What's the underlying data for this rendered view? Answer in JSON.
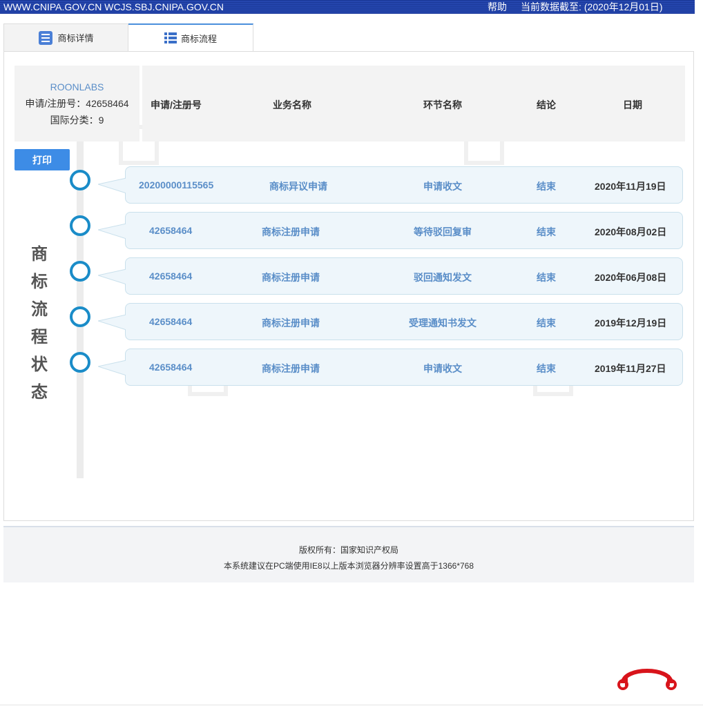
{
  "topbar": {
    "domains": "WWW.CNIPA.GOV.CN WCJS.SBJ.CNIPA.GOV.CN",
    "help": "帮助",
    "data_date_label": "当前数据截至:",
    "data_date_value": "(2020年12月01日)"
  },
  "tabs": [
    {
      "label": "商标详情",
      "icon": "list-icon"
    },
    {
      "label": "商标流程",
      "icon": "grid-list-icon"
    }
  ],
  "info": {
    "brand": "ROONLABS",
    "reg_no_line": "申请/注册号：42658464",
    "class_line": "国际分类：9"
  },
  "table": {
    "headers": [
      "申请/注册号",
      "业务名称",
      "环节名称",
      "结论",
      "日期"
    ]
  },
  "print_label": "打印",
  "vertical_title": [
    "商",
    "标",
    "流",
    "程",
    "状",
    "态"
  ],
  "rows": [
    {
      "reg_no": "20200000115565",
      "business": "商标异议申请",
      "step": "申请收文",
      "result": "结束",
      "date": "2020年11月19日"
    },
    {
      "reg_no": "42658464",
      "business": "商标注册申请",
      "step": "等待驳回复审",
      "result": "结束",
      "date": "2020年08月02日"
    },
    {
      "reg_no": "42658464",
      "business": "商标注册申请",
      "step": "驳回通知发文",
      "result": "结束",
      "date": "2020年06月08日"
    },
    {
      "reg_no": "42658464",
      "business": "商标注册申请",
      "step": "受理通知书发文",
      "result": "结束",
      "date": "2019年12月19日"
    },
    {
      "reg_no": "42658464",
      "business": "商标注册申请",
      "step": "申请收文",
      "result": "结束",
      "date": "2019年11月27日"
    }
  ],
  "footer": {
    "copyright": "版权所有：国家知识产权局",
    "note": "本系统建议在PC端使用IE8以上版本浏览器分辨率设置高于1366*768"
  },
  "colors": {
    "accent": "#3d8ce6",
    "node": "#1a8cc8",
    "link_text": "#5a8ec8",
    "logo": "#d8141b"
  }
}
